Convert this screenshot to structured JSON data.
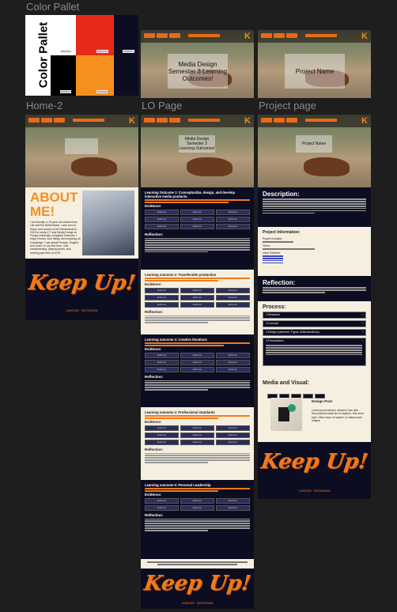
{
  "canvas": {
    "background": "#1e1e1e"
  },
  "frames": {
    "color_pallet": {
      "label": "Color Pallet",
      "swatch_title": "Color Pallet",
      "colors": [
        "#ffffff",
        "#e82a1a",
        "#0d0d22",
        "#000000",
        "#f5901e"
      ],
      "swatch_codes": [
        "#FFFFFF",
        "#E82A1A",
        "#0D0D22",
        "#000000",
        "#F5901E"
      ]
    },
    "home": {
      "label": "Home-2",
      "hero_text": "",
      "about_title": "ABOUT ME!",
      "about_body": "I am Noortje, a 19-year-old student from Lier and the Netherlands. I was born in Hoorn and moved to the Netherlands in 2022 to study ICT and Media Design at Fontys University of Applied Sciences. I enjoy Horses, love things and exploring all knowledge. I can speak Persian, English, and Dutch. In my free time, I like snowboarding, playing sports, and working part-time at KGH.",
      "keep_up": "Keep Up!",
      "footer": "LINKEDIN · INSTAGRAM"
    },
    "lo_page": {
      "label": "LO Page",
      "hero_text": "Media Design Semester 3 Learning Outcomes!",
      "outcomes": [
        {
          "title": "Learning Outcome 1: Conceptualize, design, and develop interactive media products.",
          "theme": "navy"
        },
        {
          "title": "Learning outcome 2: Transferable production",
          "theme": "cream"
        },
        {
          "title": "Learning outcome 3: Creative iterations",
          "theme": "navy"
        },
        {
          "title": "Learning outcome 4: Professional standards",
          "theme": "cream"
        },
        {
          "title": "Learning outcome 5: Personal Leadership",
          "theme": "navy"
        }
      ],
      "evidence_label": "Evidence:",
      "reflection_label": "Reflection:",
      "evidence_cell": "Evidence",
      "keep_up": "Keep Up!",
      "footer": "LINKEDIN · INSTAGRAM"
    },
    "project_page": {
      "label": "Project page",
      "hero_text": "Project Name",
      "description_title": "Description:",
      "info_title": "Project Information:",
      "info_items": [
        "Project Duration:",
        "Client:",
        "Used Software:"
      ],
      "reflection_title": "Reflection:",
      "process_title": "Process:",
      "process_steps": [
        "1.Research",
        "2.Concept",
        "3.Design (sketches, Figma, initial iterations)",
        "4.Presentation"
      ],
      "media_title": "Media and Visual:",
      "design_title": "Design Post",
      "design_body": "Lorem ipsum tempor ultricies Cras nibh. Sed pharetra vitae dui et dapibus. Nisl amet eget. Vitae fusce sit sapien, ut ullamcorper magna.",
      "keep_up": "Keep Up!",
      "footer": "LINKEDIN · INSTAGRAM"
    }
  }
}
